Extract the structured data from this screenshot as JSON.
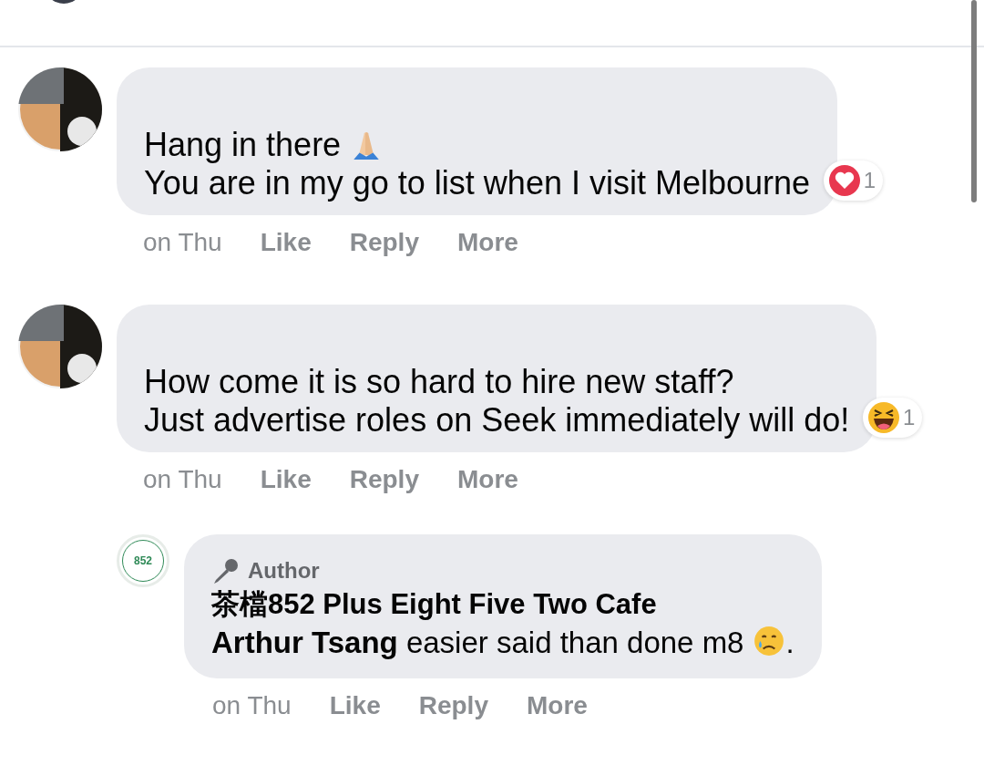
{
  "comments": [
    {
      "avatar": {
        "kind": "picture"
      },
      "lines": [
        {
          "kind": "pray",
          "text": "Hang in there"
        },
        {
          "kind": "plain",
          "text": "You are in my go to list when I visit Melbourne"
        }
      ],
      "reaction": {
        "kind": "love",
        "count": "1"
      },
      "time": "on Thu",
      "actions": [
        "Like",
        "Reply",
        "More"
      ]
    },
    {
      "avatar": {
        "kind": "picture"
      },
      "lines": [
        {
          "kind": "plain",
          "text": "How come it is so hard to hire new staff?"
        },
        {
          "kind": "plain",
          "text": "Just advertise roles on Seek immediately will do!"
        }
      ],
      "reaction": {
        "kind": "haha",
        "count": "1"
      },
      "time": "on Thu",
      "actions": [
        "Like",
        "Reply",
        "More"
      ],
      "replies": [
        {
          "avatar": {
            "kind": "logo",
            "text": "852"
          },
          "badge": "Author",
          "author": "茶檔852 Plus Eight Five Two Cafe",
          "lines": [
            {
              "kind": "crying",
              "text": "**Arthur Tsang** easier said than done m8",
              "after": "."
            }
          ],
          "time": "on Thu",
          "actions": [
            "Like",
            "Reply",
            "More"
          ]
        }
      ]
    }
  ]
}
